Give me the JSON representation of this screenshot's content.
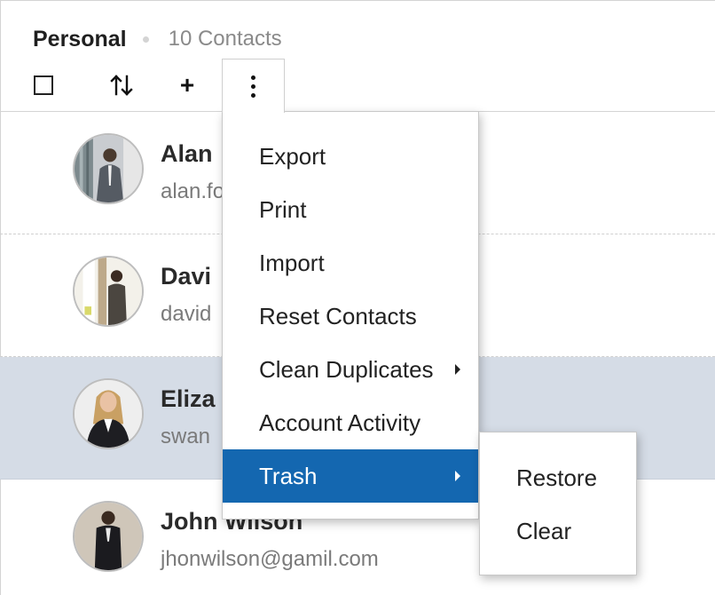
{
  "header": {
    "title": "Personal",
    "count": "10 Contacts"
  },
  "toolbar": {
    "select_all_icon": "checkbox-icon",
    "sort_icon": "sort-icon",
    "add_icon": "plus-icon",
    "add_label": "+",
    "more_icon": "more-vertical-icon"
  },
  "contacts": [
    {
      "name": "Alan",
      "email": "alan.fo",
      "selected": false
    },
    {
      "name": "Davi",
      "email": "david",
      "selected": false
    },
    {
      "name": "Eliza",
      "email": "swan",
      "selected": true
    },
    {
      "name": "John Wilson",
      "email": "jhonwilson@gamil.com",
      "selected": false
    }
  ],
  "menu": {
    "items": [
      {
        "label": "Export"
      },
      {
        "label": "Print"
      },
      {
        "label": "Import"
      },
      {
        "label": "Reset Contacts"
      },
      {
        "label": "Clean Duplicates"
      },
      {
        "label": "Account Activity"
      },
      {
        "label": "Trash"
      }
    ],
    "active_color": "#1467b0"
  },
  "submenu": {
    "items": [
      {
        "label": "Restore"
      },
      {
        "label": "Clear"
      }
    ]
  },
  "colors": {
    "selected_row": "#d5dce6",
    "accent": "#1467b0"
  }
}
